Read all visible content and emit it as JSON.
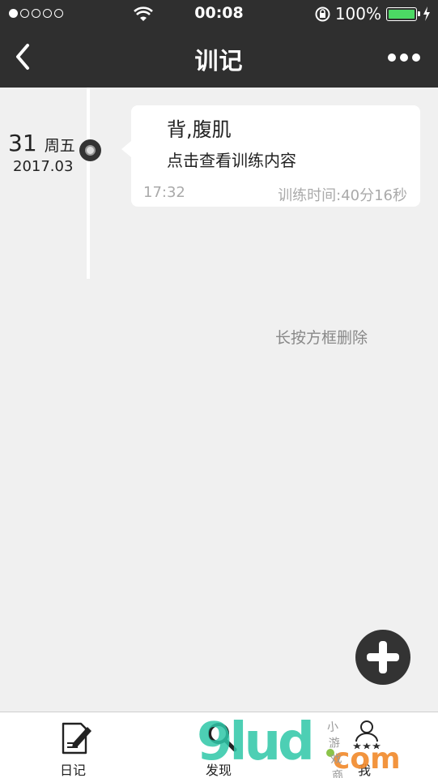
{
  "status_bar": {
    "time": "00:08",
    "battery_percent": "100%",
    "battery_level": 1.0,
    "signal_dots": [
      true,
      false,
      false,
      false,
      false
    ]
  },
  "nav": {
    "title": "训记",
    "back_icon": "chevron-left-icon",
    "more_icon": "more-dots-icon"
  },
  "timeline": {
    "date": {
      "day": "31",
      "weekday": "周五",
      "year_month": "2017.03"
    },
    "entry": {
      "title": "背,腹肌",
      "subtitle": "点击查看训练内容",
      "time": "17:32",
      "duration": "训练时间:40分16秒"
    }
  },
  "hint": "长按方框删除",
  "fab": {
    "icon": "plus-icon"
  },
  "tabbar": {
    "tabs": [
      {
        "label": "日记",
        "icon": "diary-pencil-icon"
      },
      {
        "label": "发现",
        "icon": "search-icon"
      },
      {
        "label": "我",
        "icon": "profile-stars-icon"
      }
    ]
  },
  "watermark": {
    "main": "9lud",
    "suffix": "com",
    "shop": "小 游 戏 商 店"
  },
  "colors": {
    "topbar": "#2f2f2f",
    "background": "#f0f0f0",
    "battery": "#4cd964",
    "fab": "#333333"
  }
}
